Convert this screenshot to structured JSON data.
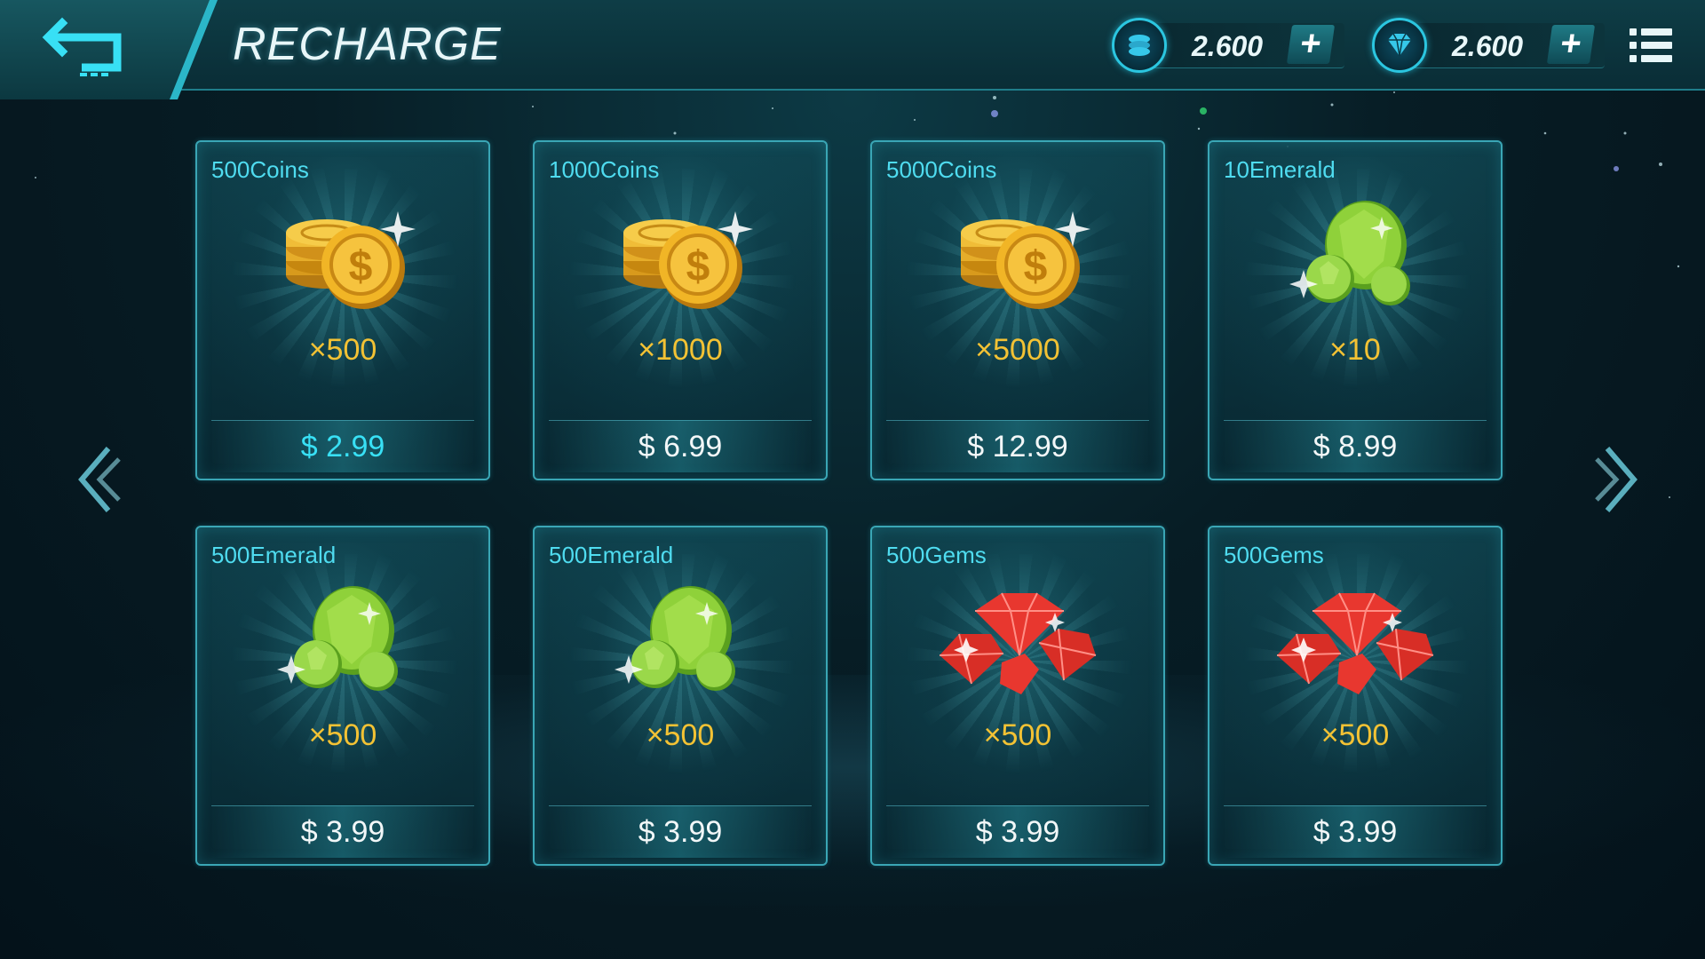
{
  "header": {
    "title": "RECHARGE",
    "coins_amount": "2.600",
    "gems_amount": "2.600",
    "plus_label": "+"
  },
  "colors": {
    "accent": "#38e0f5",
    "name_text": "#4fdcf0",
    "quantity_text": "#f3c234",
    "coin_gold": "#f1b526",
    "emerald_green": "#8fd13a",
    "gem_red": "#e8372f"
  },
  "icons": {
    "back": "back-arrow-icon",
    "coins": "coin-stack-icon",
    "gems": "diamond-icon",
    "menu": "hamburger-menu-icon",
    "prev": "double-chevron-left-icon",
    "next": "double-chevron-right-icon"
  },
  "products": [
    {
      "name": "500Coins",
      "qty": "×500",
      "price": "$  2.99",
      "art": "coins",
      "highlight": true
    },
    {
      "name": "1000Coins",
      "qty": "×1000",
      "price": "$  6.99",
      "art": "coins",
      "highlight": false
    },
    {
      "name": "5000Coins",
      "qty": "×5000",
      "price": "$  12.99",
      "art": "coins",
      "highlight": false
    },
    {
      "name": "10Emerald",
      "qty": "×10",
      "price": "$  8.99",
      "art": "emerald",
      "highlight": false
    },
    {
      "name": "500Emerald",
      "qty": "×500",
      "price": "$  3.99",
      "art": "emerald",
      "highlight": false
    },
    {
      "name": "500Emerald",
      "qty": "×500",
      "price": "$  3.99",
      "art": "emerald",
      "highlight": false
    },
    {
      "name": "500Gems",
      "qty": "×500",
      "price": "$  3.99",
      "art": "gems",
      "highlight": false
    },
    {
      "name": "500Gems",
      "qty": "×500",
      "price": "$  3.99",
      "art": "gems",
      "highlight": false
    }
  ]
}
